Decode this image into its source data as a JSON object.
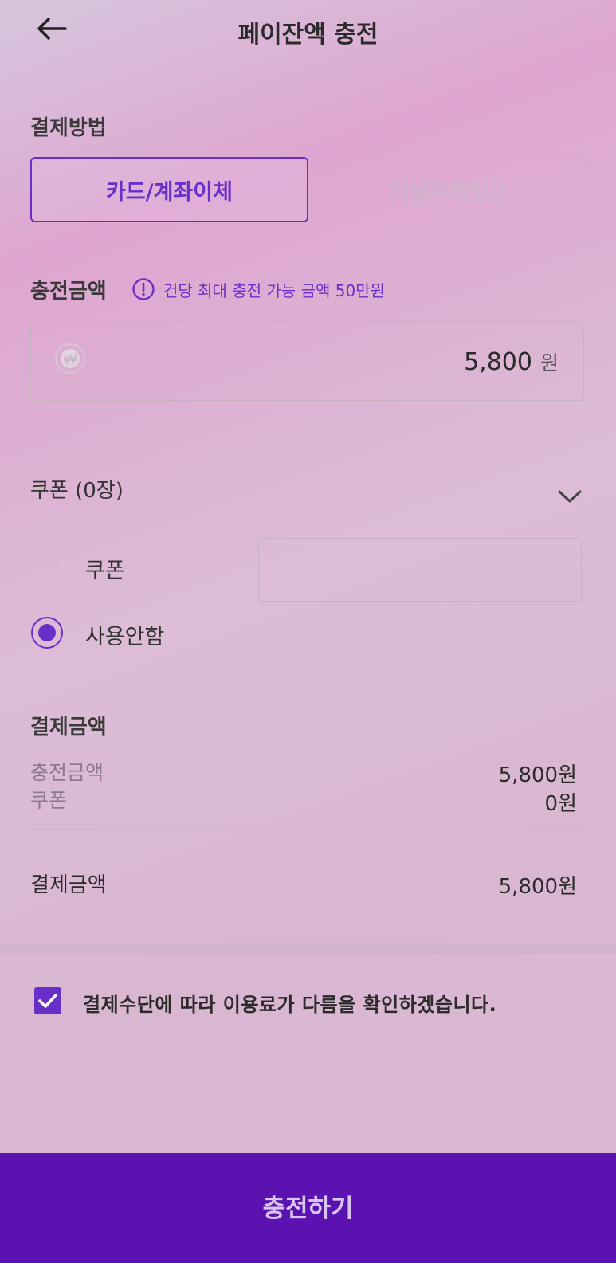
{
  "header": {
    "title": "페이잔액 충전"
  },
  "payment_method": {
    "label": "결제방법",
    "tabs": [
      {
        "label": "카드/계좌이체",
        "selected": true
      },
      {
        "label": "가상계좌입금",
        "selected": false
      }
    ]
  },
  "charge_amount": {
    "label": "충전금액",
    "info": "건당 최대 충전 가능 금액 50만원",
    "value": "5,800",
    "unit": "원"
  },
  "coupon": {
    "label": "쿠폰 (0장)",
    "options": [
      {
        "label": "쿠폰",
        "selected": false
      },
      {
        "label": "사용안함",
        "selected": true
      }
    ],
    "input_value": ""
  },
  "summary": {
    "title": "결제금액",
    "rows": [
      {
        "label": "충전금액",
        "value": "5,800원"
      },
      {
        "label": "쿠폰",
        "value": "0원"
      }
    ],
    "total_label": "결제금액",
    "total_value": "5,800원"
  },
  "agreement": {
    "text": "결제수단에 따라 이용료가 다름을 확인하겠습니다.",
    "checked": true
  },
  "submit": {
    "label": "충전하기"
  },
  "colors": {
    "accent": "#6b2fc9",
    "button": "#5a12b0"
  }
}
